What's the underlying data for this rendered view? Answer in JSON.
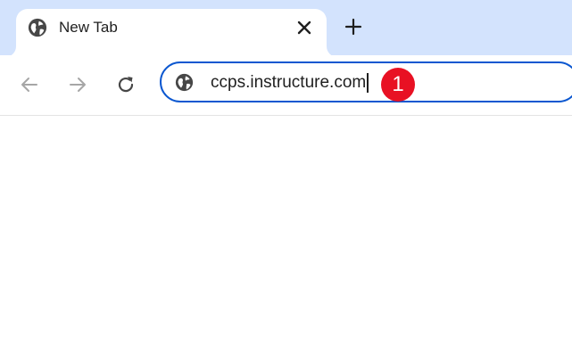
{
  "tab": {
    "title": "New Tab",
    "favicon": "globe-icon",
    "close_icon": "close-icon"
  },
  "new_tab_icon": "plus-icon",
  "toolbar": {
    "back_icon": "arrow-left-icon",
    "forward_icon": "arrow-right-icon",
    "reload_icon": "reload-icon"
  },
  "omnibox": {
    "icon": "globe-icon",
    "value": "ccps.instructure.com",
    "focused": true
  },
  "annotation": {
    "step_number": "1",
    "color": "#e81123"
  },
  "colors": {
    "tabstrip": "#d3e3fd",
    "focus_ring": "#0b57d0"
  }
}
